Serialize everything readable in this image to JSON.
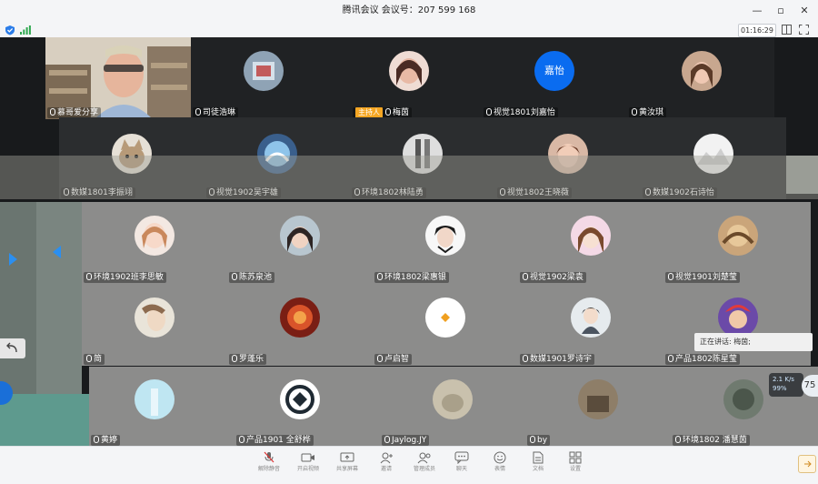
{
  "window": {
    "title": "腾讯会议 会议号：207 599 168",
    "timer": "01:16:29",
    "controls": [
      "—",
      "▫",
      "✕"
    ]
  },
  "participants": [
    {
      "name": "慕哥爱分享",
      "type": "video"
    },
    {
      "name": "司徒浩琳"
    },
    {
      "name": "梅茵",
      "host_label": "主持人"
    },
    {
      "name": "视觉1801刘嘉怡",
      "avatar_text": "嘉怡"
    },
    {
      "name": "黄汝琪"
    },
    {
      "name": "数媒1801李振翊"
    },
    {
      "name": "视觉1902吴宇雄"
    },
    {
      "name": "环境1802林陆勇"
    },
    {
      "name": "视觉1802王晓薇"
    },
    {
      "name": "数媒1902石诗怡"
    },
    {
      "name": "环境1902班李思敏"
    },
    {
      "name": "陈苏泉池"
    },
    {
      "name": "环境1802梁惠银"
    },
    {
      "name": "视觉1902梁袁"
    },
    {
      "name": "视觉1901刘楚莹"
    },
    {
      "name": "简"
    },
    {
      "name": "罗蓬乐"
    },
    {
      "name": "卢启智"
    },
    {
      "name": "数媒1901罗诗宇"
    },
    {
      "name": "产品1802陈星莹"
    },
    {
      "name": "黄婷"
    },
    {
      "name": "产品1901 全舒桦"
    },
    {
      "name": "Jaylog.JY"
    },
    {
      "name": "by"
    },
    {
      "name": "环境1802 潘慧茵"
    }
  ],
  "speaking": "正在讲话: 梅茵;",
  "network": {
    "speed": "2.1 K/s",
    "pct": "99%",
    "side_num": "75"
  },
  "toolbar": {
    "labels": [
      "解除静音",
      "开启视频",
      "共享屏幕",
      "邀请",
      "管理成员",
      "聊天",
      "表情",
      "文档",
      "设置"
    ]
  },
  "colors": {
    "accent": "#0a6cf0",
    "host": "#f5a623"
  }
}
